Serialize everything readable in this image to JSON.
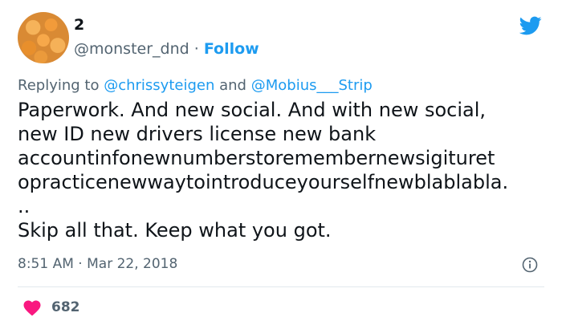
{
  "user": {
    "name": "2",
    "handle": "@monster_dnd",
    "separator": "·",
    "follow_label": "Follow"
  },
  "reply": {
    "prefix": "Replying to",
    "mention1": "@chrissyteigen",
    "conjunction": "and",
    "mention2": "@Mobius___Strip"
  },
  "tweet": {
    "lines": [
      "Paperwork. And new social. And with new social,",
      "new ID new drivers license new bank",
      "accountinfonewnumberstoremembernewsigituret",
      "opracticenewwaytointroduceyourselfnewblablabla.",
      "..",
      "Skip all that. Keep what you got."
    ]
  },
  "meta": {
    "time": "8:51 AM",
    "separator": "·",
    "date": "Mar 22, 2018"
  },
  "engagement": {
    "likes": "682"
  },
  "icons": {
    "logo": "twitter-bird-icon",
    "info": "info-icon",
    "like": "heart-icon"
  },
  "colors": {
    "accent": "#1d9bf0",
    "heart": "#f91880",
    "muted": "#536471"
  }
}
